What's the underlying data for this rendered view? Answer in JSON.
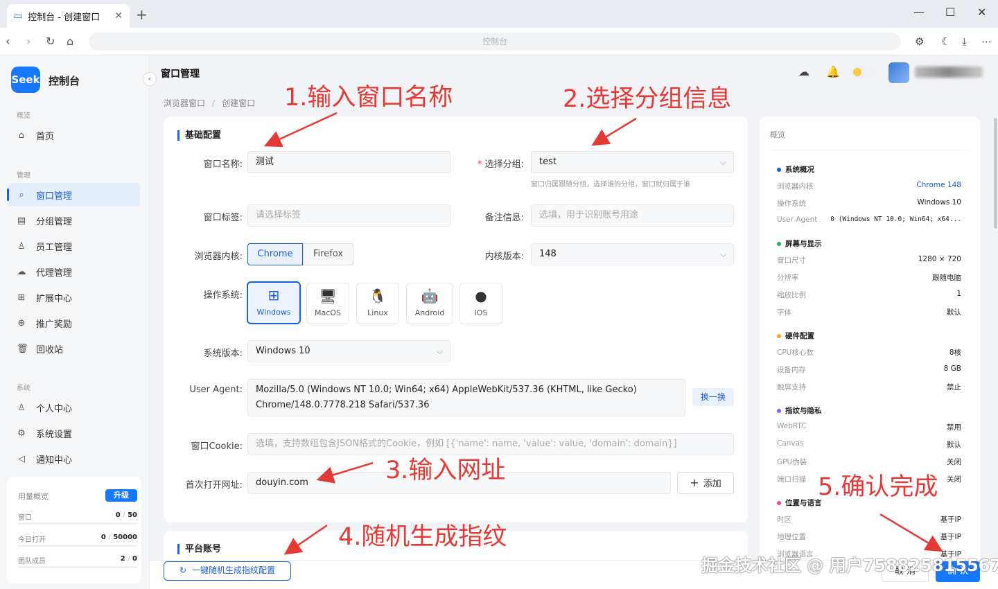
{
  "browser": {
    "tab_title": "控制台 - 创建窗口",
    "url": "控制台"
  },
  "sidebar": {
    "brand": "Seek",
    "app_name": "控制台",
    "sections": {
      "overview": "概览",
      "manage": "管理",
      "system": "系统"
    },
    "items": [
      {
        "label": "首页",
        "icon": "home-icon"
      },
      {
        "label": "窗口管理",
        "icon": "search-icon",
        "active": true
      },
      {
        "label": "分组管理",
        "icon": "folder-icon"
      },
      {
        "label": "员工管理",
        "icon": "users-icon"
      },
      {
        "label": "代理管理",
        "icon": "cloud-icon"
      },
      {
        "label": "扩展中心",
        "icon": "grid-icon"
      },
      {
        "label": "推广奖励",
        "icon": "gift-icon"
      },
      {
        "label": "回收站",
        "icon": "trash-icon"
      },
      {
        "label": "个人中心",
        "icon": "user-icon"
      },
      {
        "label": "系统设置",
        "icon": "gear-icon"
      },
      {
        "label": "通知中心",
        "icon": "megaphone-icon"
      }
    ],
    "usage": {
      "title": "用量概览",
      "upgrade": "升级",
      "rows": [
        {
          "label": "窗口",
          "used": "0",
          "total": "50"
        },
        {
          "label": "今日打开",
          "used": "0",
          "total": "50000"
        },
        {
          "label": "团队成员",
          "used": "2",
          "total": "0"
        }
      ]
    }
  },
  "header": {
    "title": "窗口管理",
    "breadcrumb": [
      "浏览器窗口",
      "创建窗口"
    ]
  },
  "form": {
    "section_title": "基础配置",
    "name_label": "窗口名称:",
    "name_value": "测试",
    "group_label": "选择分组:",
    "group_value": "test",
    "group_hint": "窗口归属跟随分组，选择谁的分组，窗口就归属于谁",
    "tag_label": "窗口标签:",
    "tag_placeholder": "请选择标签",
    "note_label": "备注信息:",
    "note_placeholder": "选填，用于识别账号用途",
    "core_label": "浏览器内核:",
    "core_options": [
      "Chrome",
      "Firefox"
    ],
    "core_version_label": "内核版本:",
    "core_version": "148",
    "os_label": "操作系统:",
    "os_options": [
      "Windows",
      "MacOS",
      "Linux",
      "Android",
      "IOS"
    ],
    "sys_version_label": "系统版本:",
    "sys_version": "Windows 10",
    "ua_label": "User Agent:",
    "ua_value_line1": "Mozilla/5.0 (Windows NT 10.0; Win64; x64) AppleWebKit/537.36 (KHTML, like Gecko)",
    "ua_value_line2": "Chrome/148.0.7778.218 Safari/537.36",
    "ua_switch": "换一换",
    "cookie_label": "窗口Cookie:",
    "cookie_placeholder": "选填，支持数组包含JSON格式的Cookie，例如 [{'name': name, 'value': value, 'domain': domain}]",
    "url_label": "首次打开网址:",
    "url_value": "douyin.com",
    "add_label": "添加",
    "platform_title": "平台账号"
  },
  "overview": {
    "title": "概览",
    "sections": [
      {
        "title": "系统概况",
        "color": "#1a5fd6",
        "rows": [
          [
            "浏览器内核",
            "Chrome 148"
          ],
          [
            "操作系统",
            "Windows 10"
          ],
          [
            "User Agent",
            "0 (Windows NT 10.0; Win64; x64..."
          ]
        ]
      },
      {
        "title": "屏幕与显示",
        "color": "#22b35e",
        "rows": [
          [
            "窗口尺寸",
            "1280 × 720"
          ],
          [
            "分辨率",
            "跟随电脑"
          ],
          [
            "缩放比例",
            "1"
          ],
          [
            "字体",
            "默认"
          ]
        ]
      },
      {
        "title": "硬件配置",
        "color": "#f5a623",
        "rows": [
          [
            "CPU核心数",
            "8核"
          ],
          [
            "设备内存",
            "8 GB"
          ],
          [
            "触屏支持",
            "禁止"
          ]
        ]
      },
      {
        "title": "指纹与隐私",
        "color": "#8b5cf6",
        "rows": [
          [
            "WebRTC",
            "禁用"
          ],
          [
            "Canvas",
            "默认"
          ],
          [
            "GPU伪装",
            "关闭"
          ],
          [
            "端口扫描",
            "关闭"
          ]
        ]
      },
      {
        "title": "位置与语言",
        "color": "#ec4899",
        "rows": [
          [
            "时区",
            "基于IP"
          ],
          [
            "地理位置",
            "基于IP"
          ],
          [
            "浏览器语言",
            "基于IP"
          ]
        ]
      }
    ]
  },
  "footer": {
    "random": "一键随机生成指纹配置",
    "cancel": "取 消",
    "confirm": "确 认"
  },
  "annotations": [
    "1.输入窗口名称",
    "2.选择分组信息",
    "3.输入网址",
    "4.随机生成指纹",
    "5.确认完成"
  ],
  "watermark": "掘金技术社区 @ 用户7588258155​67"
}
